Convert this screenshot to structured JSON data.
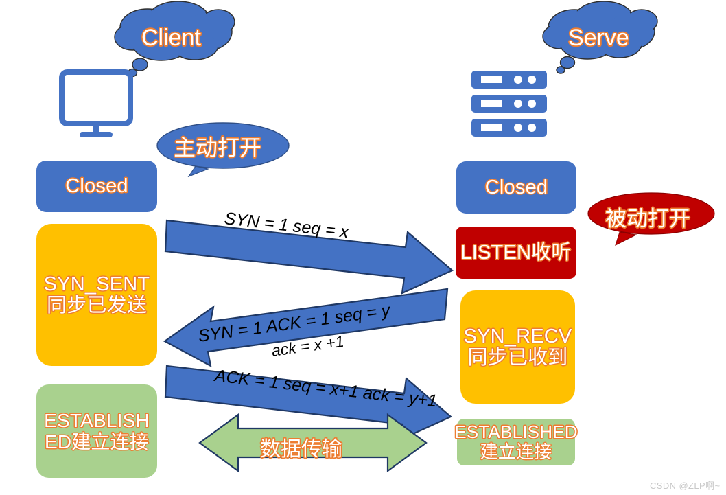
{
  "diagram": {
    "title": "TCP three-way handshake",
    "colors": {
      "blue": "#4472c4",
      "amber": "#ffc000",
      "green": "#a9d18e",
      "red": "#c00000",
      "arrow_outline": "#1f3864",
      "text_fill": "#ffffff",
      "text_outline": "#ed7d31",
      "watermark": "#c8c8c8"
    }
  },
  "actors": {
    "client": {
      "cloud_label": "Client",
      "icon": "monitor-icon"
    },
    "server": {
      "cloud_label": "Serve",
      "icon": "server-rack-icon"
    }
  },
  "callouts": [
    {
      "id": "active-open",
      "label": "主动打开",
      "color": "#4472c4"
    },
    {
      "id": "passive-open",
      "label": "被动打开",
      "color": "#c00000"
    }
  ],
  "client_states": [
    {
      "id": "closed",
      "label": "Closed",
      "color": "#4472c4"
    },
    {
      "id": "syn-sent",
      "label": "SYN_SENT\n同步已发送",
      "color": "#ffc000"
    },
    {
      "id": "established",
      "label": "ESTABLISHED建立连接",
      "color": "#a9d18e"
    }
  ],
  "server_states": [
    {
      "id": "closed",
      "label": "Closed",
      "color": "#4472c4"
    },
    {
      "id": "listen",
      "label": "LISTEN收听",
      "color": "#c00000"
    },
    {
      "id": "syn-recv",
      "label": "SYN_RECV\n同步已收到",
      "color": "#ffc000"
    },
    {
      "id": "established",
      "label": "ESTABLISHED\n建立连接",
      "color": "#a9d18e"
    }
  ],
  "messages": [
    {
      "id": "msg-1-syn",
      "direction": "client-to-server",
      "line_above": "SYN = 1  seq = x",
      "line_below": ""
    },
    {
      "id": "msg-2-syn-ack",
      "direction": "server-to-client",
      "line_above": "SYN = 1 ACK = 1 seq = y",
      "line_below": "ack = x +1"
    },
    {
      "id": "msg-3-ack",
      "direction": "client-to-server",
      "line_above": "ACK = 1 seq = x+1 ack = y+1",
      "line_below": ""
    }
  ],
  "data_flow": {
    "id": "data-transfer",
    "label": "数据传输",
    "color": "#a9d18e"
  },
  "watermark": {
    "text": "CSDN @ZLP啊~"
  }
}
